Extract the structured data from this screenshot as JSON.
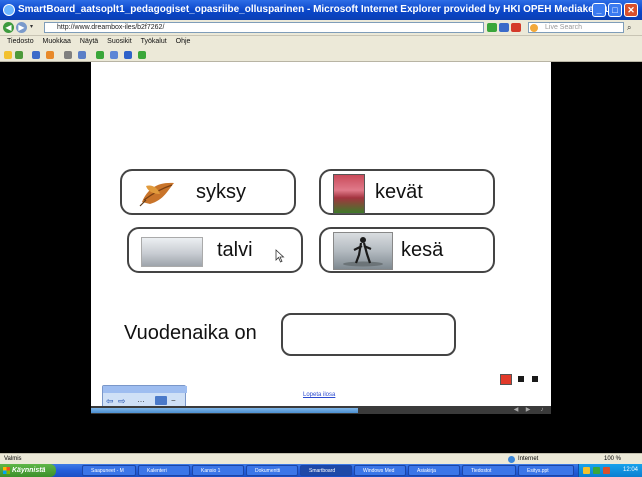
{
  "window": {
    "title": "SmartBoard_aatsoplt1_pedagogiset_opasriibe_ollusparinen - Microsoft Internet Explorer provided by HKI OPEH Mediakeskus",
    "minimize": "_",
    "maximize": "□",
    "close": "✕"
  },
  "address_bar": {
    "back": "◀",
    "forward": "▶",
    "url": "http://www.dreambox-iles/b2f7262/",
    "search_placeholder": "Live Search"
  },
  "menu": [
    "Tiedosto",
    "Muokkaa",
    "Näytä",
    "Suosikit",
    "Työkalut",
    "Ohje"
  ],
  "toolbar_icon_names": [
    "favorites-star-icon",
    "add-favorites-icon",
    "home-icon",
    "feeds-icon",
    "print-icon",
    "page-icon",
    "safety-icon",
    "tools-icon",
    "help-icon",
    "research-icon"
  ],
  "slide": {
    "cards": [
      {
        "label": "syksy",
        "picture": "autumn-leaf"
      },
      {
        "label": "kevät",
        "picture": "tulips"
      },
      {
        "label": "talvi",
        "picture": "snowy-landscape"
      },
      {
        "label": "kesä",
        "picture": "surfer"
      }
    ],
    "answer_label": "Vuodenaika on",
    "answer_value": "",
    "link_text": "Lopeta ilosa",
    "pager_colors": [
      "#e23a2a",
      "#1a1a1a",
      "#1a1a1a"
    ]
  },
  "progress": {
    "fraction": 0.58
  },
  "status": {
    "left": "Valmis",
    "zone": "Internet",
    "zoom": "100 %"
  },
  "taskbar": {
    "start_label": "Käynnistä",
    "tasks": [
      "Saapuneet - M",
      "Kalenteri",
      "Kansio 1",
      "Dokumentti",
      "Smartboard",
      "Windows Med",
      "Asiakirja",
      "Tiedostot",
      "Esitys.ppt"
    ],
    "active_task": 4,
    "clock": "12:04"
  }
}
